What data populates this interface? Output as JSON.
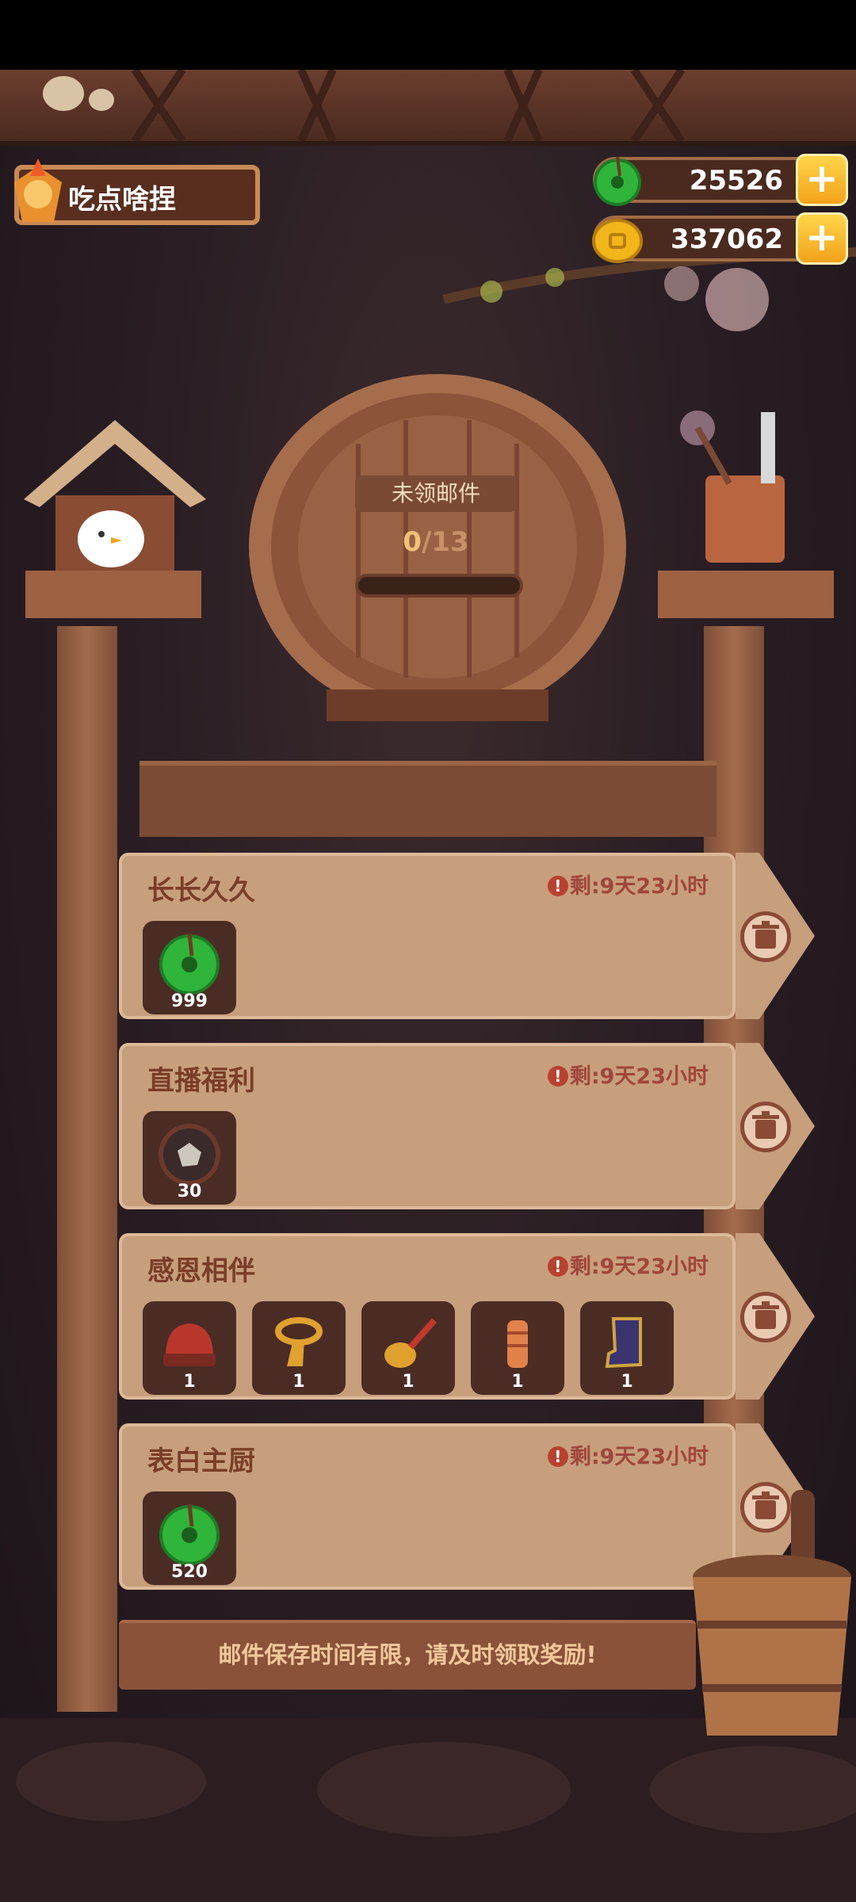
{
  "player": {
    "name": "吃点啥捏"
  },
  "currencies": [
    {
      "name": "jade",
      "value": "25526",
      "color": "#2fb53a"
    },
    {
      "name": "coin",
      "value": "337062",
      "color": "#f2b51a"
    }
  ],
  "mailbox": {
    "label": "未领邮件",
    "claimed": "0",
    "total": "/13"
  },
  "mails": [
    {
      "title": "长长久久",
      "remaining": "剩:9天23小时",
      "items": [
        {
          "icon": "jade-icon",
          "qty": "999"
        }
      ]
    },
    {
      "title": "直播福利",
      "remaining": "剩:9天23小时",
      "items": [
        {
          "icon": "ore-icon",
          "qty": "30"
        }
      ]
    },
    {
      "title": "感恩相伴",
      "remaining": "剩:9天23小时",
      "items": [
        {
          "icon": "chef-hat-icon",
          "qty": "1"
        },
        {
          "icon": "scarf-icon",
          "qty": "1"
        },
        {
          "icon": "spoon-icon",
          "qty": "1"
        },
        {
          "icon": "pepper-mill-icon",
          "qty": "1"
        },
        {
          "icon": "boot-icon",
          "qty": "1"
        }
      ]
    },
    {
      "title": "表白主厨",
      "remaining": "剩:9天23小时",
      "items": [
        {
          "icon": "jade-icon",
          "qty": "520"
        }
      ]
    }
  ],
  "footer": "邮件保存时间有限，请及时领取奖励!"
}
